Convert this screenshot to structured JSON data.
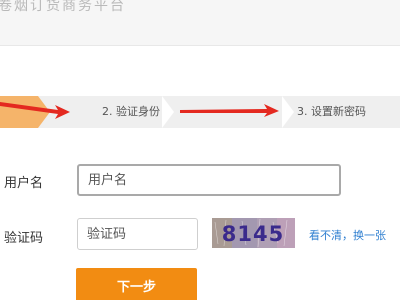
{
  "header": {
    "title": "卷烟订货商务平台"
  },
  "steps": [
    {
      "label": ""
    },
    {
      "label": "2. 验证身份"
    },
    {
      "label": "3. 设置新密码"
    }
  ],
  "form": {
    "username": {
      "label": "用户名",
      "placeholder": "用户名",
      "value": ""
    },
    "captcha": {
      "label": "验证码",
      "placeholder": "验证码",
      "value": "",
      "image_text": "8145",
      "refresh_link": "看不清，换一张"
    },
    "next_button": "下一步"
  },
  "colors": {
    "accent": "#f28c12",
    "step_active": "#f5b46a",
    "step_bg": "#efefef",
    "arrow": "#e42920",
    "link": "#2f7fd0"
  }
}
